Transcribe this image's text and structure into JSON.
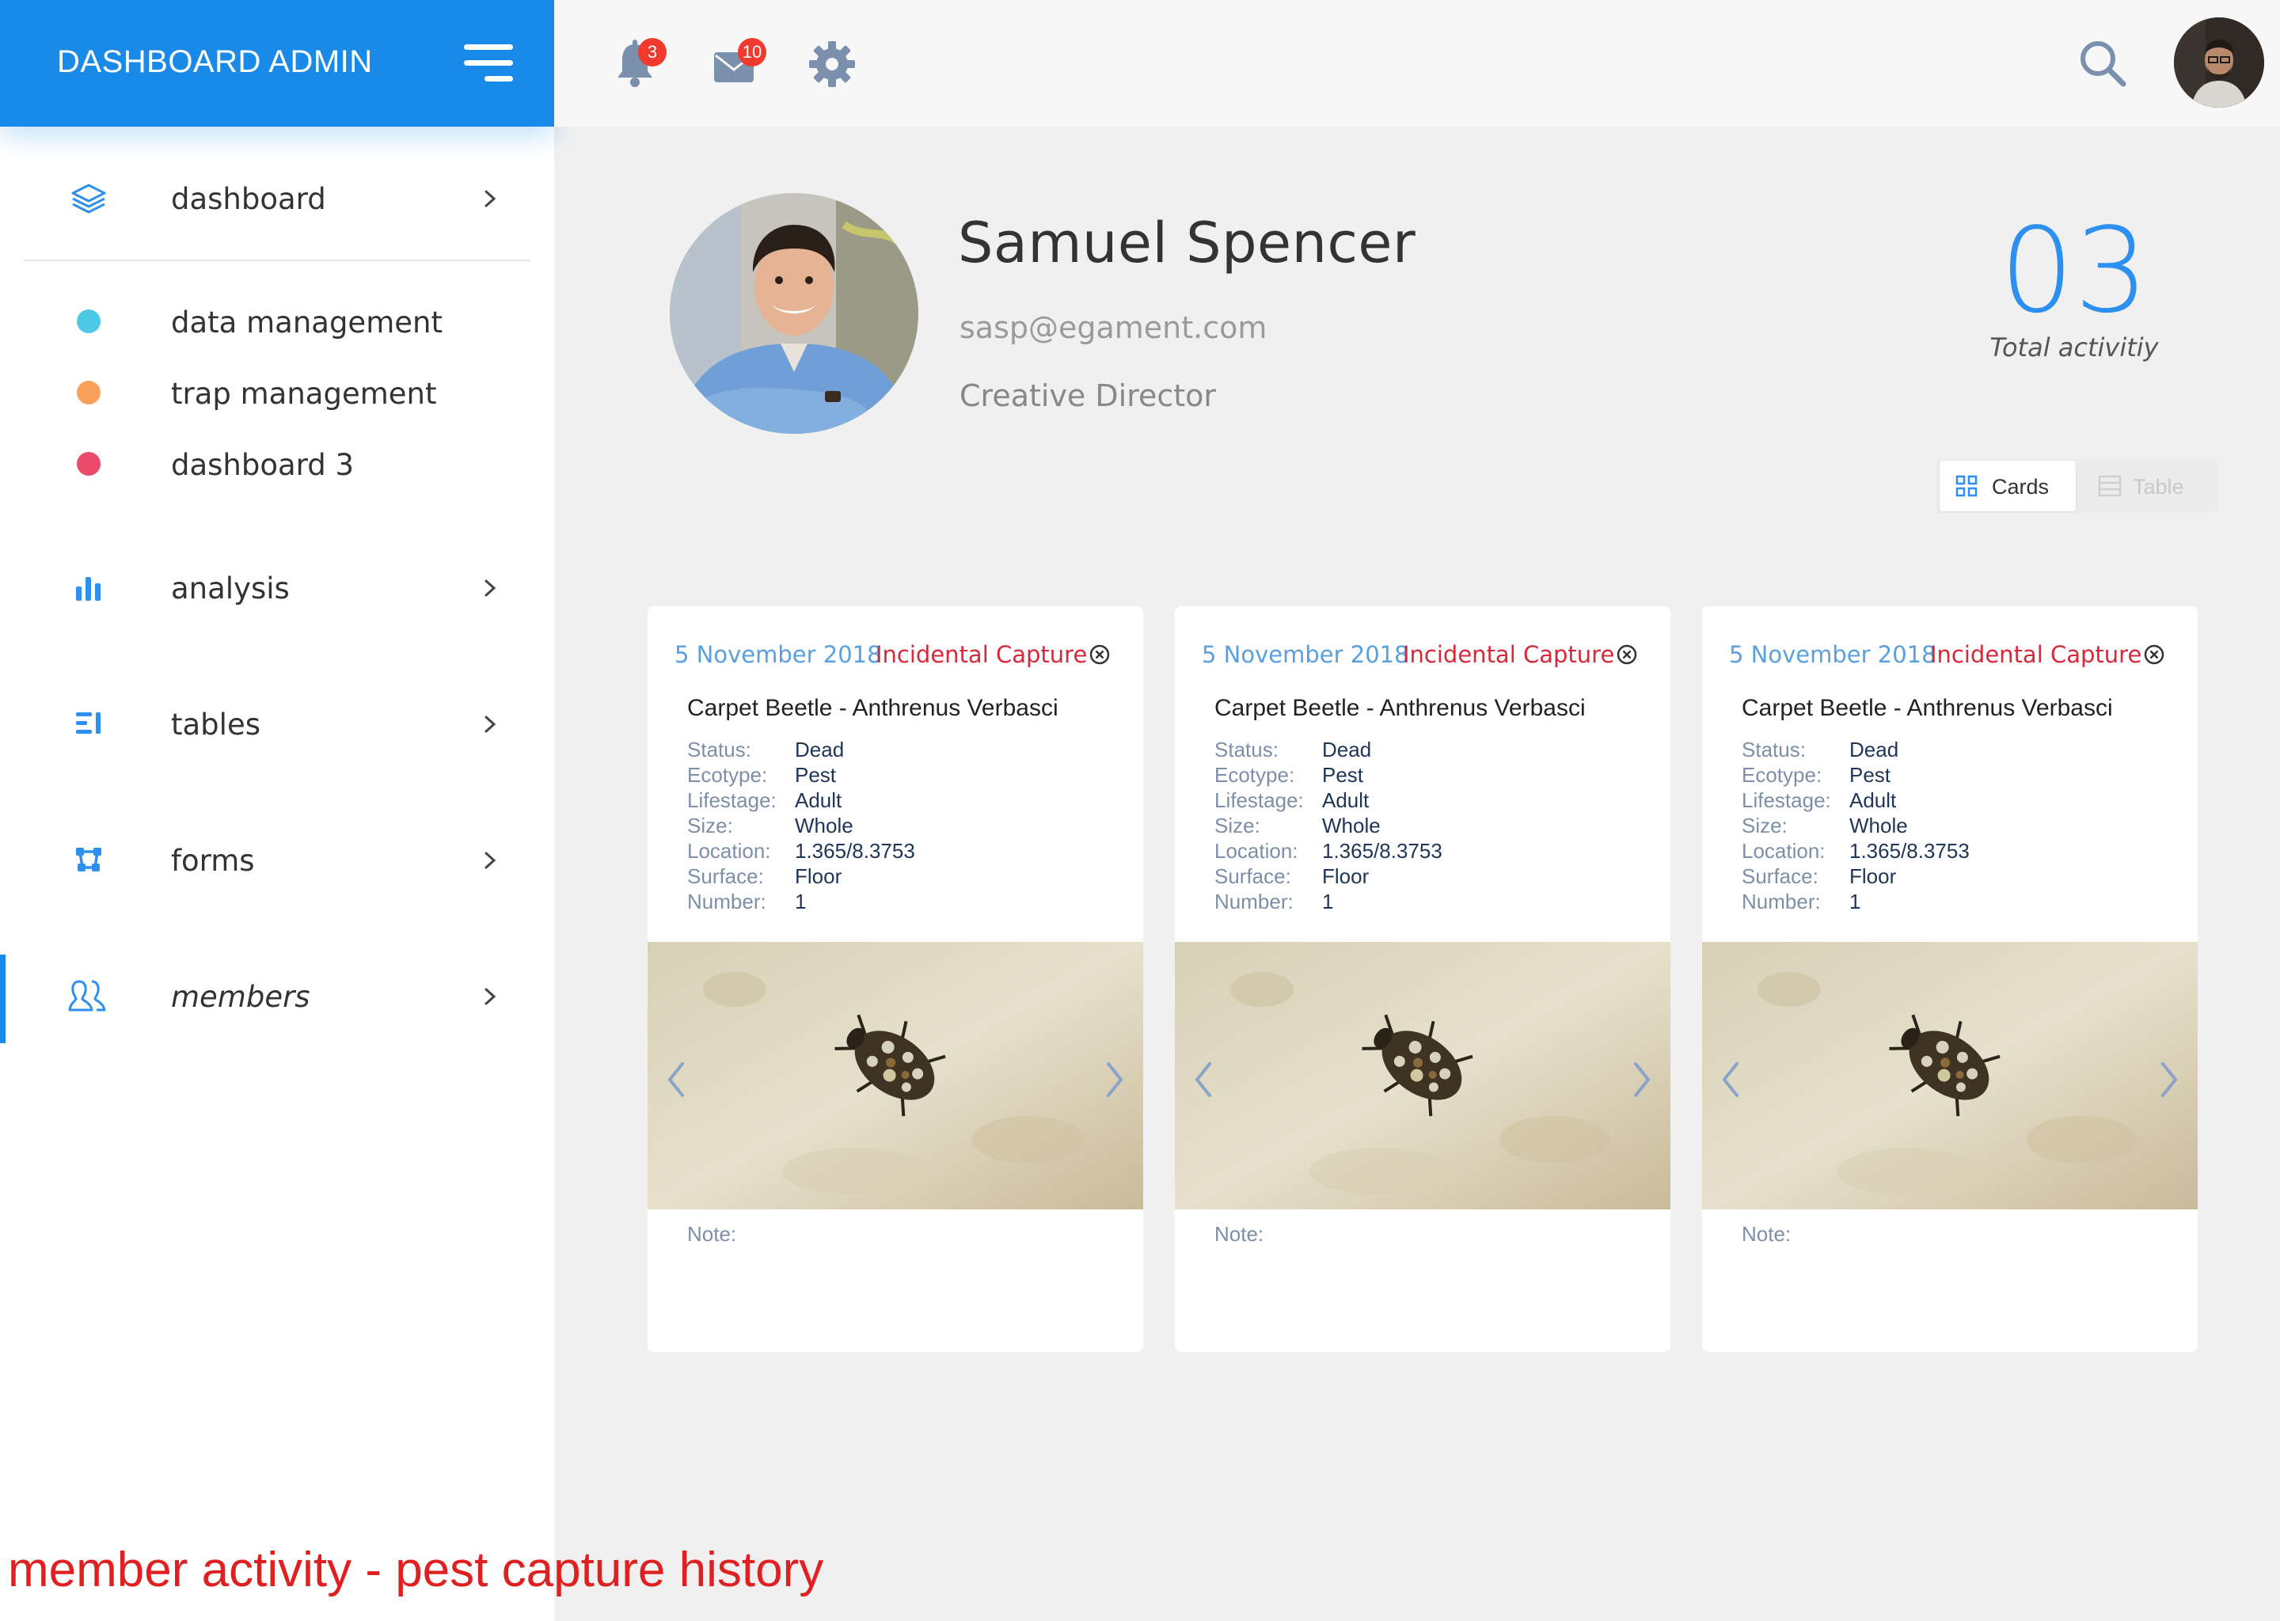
{
  "brand": {
    "title": "DASHBOARD ADMIN",
    "accent_color": "#1a8ae8"
  },
  "sidebar": {
    "items": [
      {
        "label": "dashboard",
        "icon": "layers-icon"
      },
      {
        "label": "data management",
        "icon": "dot-icon",
        "color": "#4dc9e8"
      },
      {
        "label": "trap management",
        "icon": "dot-icon",
        "color": "#f9a05a"
      },
      {
        "label": "dashboard 3",
        "icon": "dot-icon",
        "color": "#ec4a6a"
      },
      {
        "label": "analysis",
        "icon": "bar-chart-icon"
      },
      {
        "label": "tables",
        "icon": "list-icon"
      },
      {
        "label": "forms",
        "icon": "bezier-icon"
      },
      {
        "label": "members",
        "icon": "users-icon",
        "active": true
      }
    ]
  },
  "topbar": {
    "notifications_count": "3",
    "messages_count": "10"
  },
  "profile": {
    "name": "Samuel Spencer",
    "email": "sasp@egament.com",
    "role": "Creative Director",
    "total_count": "03",
    "total_label": "Total activitiy"
  },
  "view_toggle": {
    "cards": "Cards",
    "table": "Table",
    "selected": "Cards"
  },
  "cards": [
    {
      "date": "5 November 2018",
      "type": "Incidental Capture",
      "species": "Carpet Beetle - Anthrenus Verbasci",
      "fields": [
        {
          "key": "Status:",
          "value": "Dead"
        },
        {
          "key": "Ecotype:",
          "value": "Pest"
        },
        {
          "key": "Lifestage:",
          "value": "Adult"
        },
        {
          "key": "Size:",
          "value": "Whole"
        },
        {
          "key": "Location:",
          "value": "1.365/8.3753"
        },
        {
          "key": "Surface:",
          "value": "Floor"
        },
        {
          "key": "Number:",
          "value": "1"
        }
      ],
      "note": "Note:"
    },
    {
      "date": "5 November 2018",
      "type": "Incidental Capture",
      "species": "Carpet Beetle - Anthrenus Verbasci",
      "fields": [
        {
          "key": "Status:",
          "value": "Dead"
        },
        {
          "key": "Ecotype:",
          "value": "Pest"
        },
        {
          "key": "Lifestage:",
          "value": "Adult"
        },
        {
          "key": "Size:",
          "value": "Whole"
        },
        {
          "key": "Location:",
          "value": "1.365/8.3753"
        },
        {
          "key": "Surface:",
          "value": "Floor"
        },
        {
          "key": "Number:",
          "value": "1"
        }
      ],
      "note": "Note:"
    },
    {
      "date": "5 November 2018",
      "type": "Incidental Capture",
      "species": "Carpet Beetle - Anthrenus Verbasci",
      "fields": [
        {
          "key": "Status:",
          "value": "Dead"
        },
        {
          "key": "Ecotype:",
          "value": "Pest"
        },
        {
          "key": "Lifestage:",
          "value": "Adult"
        },
        {
          "key": "Size:",
          "value": "Whole"
        },
        {
          "key": "Location:",
          "value": "1.365/8.3753"
        },
        {
          "key": "Surface:",
          "value": "Floor"
        },
        {
          "key": "Number:",
          "value": "1"
        }
      ],
      "note": "Note:"
    }
  ],
  "caption": "member activity - pest capture history"
}
